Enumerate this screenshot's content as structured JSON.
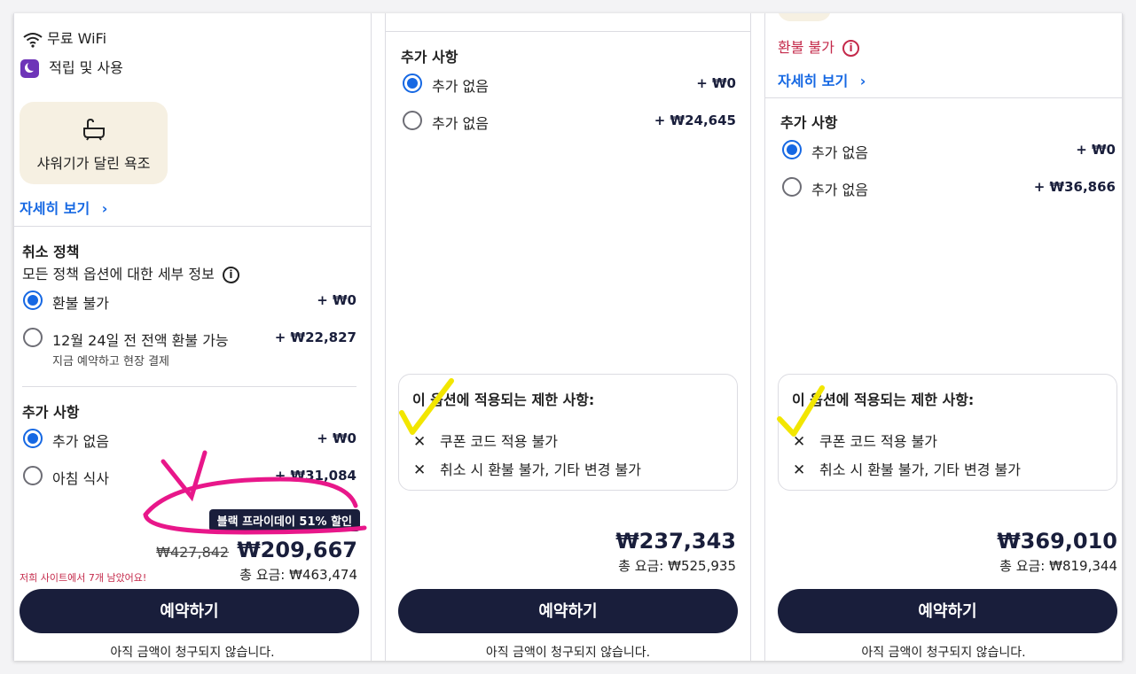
{
  "card1": {
    "amenities": [
      {
        "icon": "wifi-icon",
        "label": "무료 WiFi"
      },
      {
        "icon": "moon-icon",
        "label": "적립 및 사용"
      }
    ],
    "feature_tile": {
      "icon": "bathtub-icon",
      "label": "샤워기가 달린 욕조"
    },
    "details_link": "자세히 보기",
    "cancellation": {
      "title": "취소 정책",
      "subtitle": "모든 정책 옵션에 대한 세부 정보",
      "options": [
        {
          "label": "환불 불가",
          "price": "+ ₩0",
          "selected": true,
          "sub": ""
        },
        {
          "label": "12월 24일 전 전액 환불 가능",
          "price": "+ ₩22,827",
          "selected": false,
          "sub": "지금 예약하고 현장 결제"
        }
      ]
    },
    "extras": {
      "title": "추가 사항",
      "options": [
        {
          "label": "추가 없음",
          "price": "+ ₩0",
          "selected": true
        },
        {
          "label": "아침 식사",
          "price": "+ ₩31,084",
          "selected": false
        }
      ]
    },
    "deal_badge": "블랙 프라이데이 51% 할인",
    "old_price": "₩427,842",
    "price": "₩209,667",
    "total": "총 요금: ₩463,474",
    "availability": "저희 사이트에서 7개 남았어요!",
    "reserve_button": "예약하기",
    "no_charge_note": "아직 금액이 청구되지 않습니다."
  },
  "card2": {
    "extras": {
      "title": "추가 사항",
      "options": [
        {
          "label": "추가 없음",
          "price": "+ ₩0",
          "selected": true
        },
        {
          "label": "추가 없음",
          "price": "+ ₩24,645",
          "selected": false
        }
      ]
    },
    "restrictions": {
      "title": "이 옵션에 적용되는 제한 사항:",
      "items": [
        "쿠폰 코드 적용 불가",
        "취소 시 환불 불가, 기타 변경 불가"
      ]
    },
    "price": "₩237,343",
    "total": "총 요금: ₩525,935",
    "reserve_button": "예약하기",
    "no_charge_note": "아직 금액이 청구되지 않습니다."
  },
  "card3": {
    "refund": "환불 불가",
    "details_link": "자세히 보기",
    "extras": {
      "title": "추가 사항",
      "options": [
        {
          "label": "추가 없음",
          "price": "+ ₩0",
          "selected": true
        },
        {
          "label": "추가 없음",
          "price": "+ ₩36,866",
          "selected": false
        }
      ]
    },
    "restrictions": {
      "title": "이 옵션에 적용되는 제한 사항:",
      "items": [
        "쿠폰 코드 적용 불가",
        "취소 시 환불 불가, 기타 변경 불가"
      ]
    },
    "price": "₩369,010",
    "total": "총 요금: ₩819,344",
    "reserve_button": "예약하기",
    "no_charge_note": "아직 금액이 청구되지 않습니다."
  },
  "colors": {
    "accent": "#1668e3",
    "button": "#191e3b",
    "warning": "#c4294a",
    "annotation_pink": "#e8178a",
    "annotation_yellow": "#f2e600"
  }
}
